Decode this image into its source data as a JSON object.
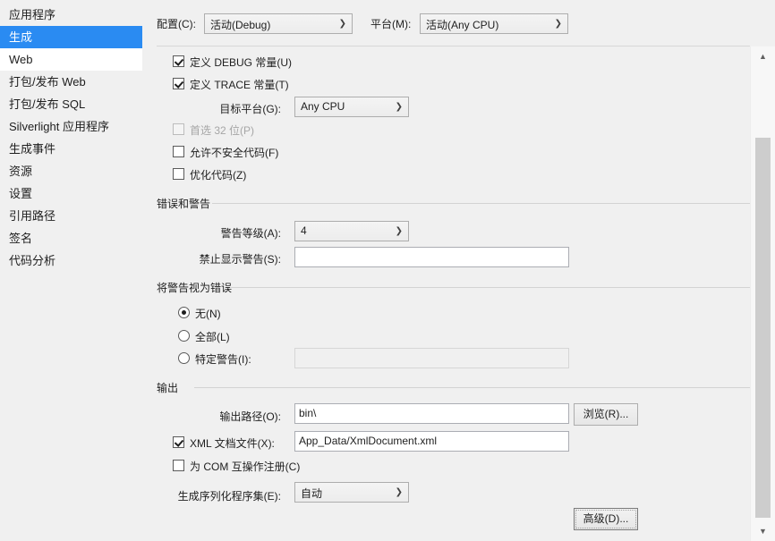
{
  "sidebar": {
    "items": [
      {
        "label": "应用程序",
        "state": "normal"
      },
      {
        "label": "生成",
        "state": "selected"
      },
      {
        "label": "Web",
        "state": "hover"
      },
      {
        "label": "打包/发布 Web",
        "state": "normal"
      },
      {
        "label": "打包/发布 SQL",
        "state": "normal"
      },
      {
        "label": "Silverlight 应用程序",
        "state": "normal"
      },
      {
        "label": "生成事件",
        "state": "normal"
      },
      {
        "label": "资源",
        "state": "normal"
      },
      {
        "label": "设置",
        "state": "normal"
      },
      {
        "label": "引用路径",
        "state": "normal"
      },
      {
        "label": "签名",
        "state": "normal"
      },
      {
        "label": "代码分析",
        "state": "normal"
      }
    ],
    "selected_color": "#2a8bf2"
  },
  "header": {
    "configuration_label": "配置(C):",
    "configuration_value": "活动(Debug)",
    "platform_label": "平台(M):",
    "platform_value": "活动(Any CPU)"
  },
  "general": {
    "define_debug_label": "定义 DEBUG 常量(U)",
    "define_debug_checked": true,
    "define_trace_label": "定义 TRACE 常量(T)",
    "define_trace_checked": true,
    "target_platform_label": "目标平台(G):",
    "target_platform_value": "Any CPU",
    "prefer32_label": "首选 32 位(P)",
    "prefer32_checked": false,
    "prefer32_disabled": true,
    "allow_unsafe_label": "允许不安全代码(F)",
    "allow_unsafe_checked": false,
    "optimize_label": "优化代码(Z)",
    "optimize_checked": false
  },
  "errors_warnings": {
    "group_title": "错误和警告",
    "warning_level_label": "警告等级(A):",
    "warning_level_value": "4",
    "suppress_warnings_label": "禁止显示警告(S):",
    "suppress_warnings_value": ""
  },
  "treat_warnings": {
    "group_title": "将警告视为错误",
    "options": [
      {
        "label": "无(N)",
        "selected": true
      },
      {
        "label": "全部(L)",
        "selected": false
      },
      {
        "label": "特定警告(I):",
        "selected": false
      }
    ],
    "specific_warnings_value": "",
    "specific_warnings_disabled": true
  },
  "output": {
    "group_title": "输出",
    "output_path_label": "输出路径(O):",
    "output_path_value": "bin\\",
    "browse_button": "浏览(R)...",
    "xml_doc_label": "XML 文档文件(X):",
    "xml_doc_checked": true,
    "xml_doc_value": "App_Data/XmlDocument.xml",
    "com_interop_label": "为 COM 互操作注册(C)",
    "com_interop_checked": false,
    "serialization_label": "生成序列化程序集(E):",
    "serialization_value": "自动",
    "advanced_button": "高级(D)..."
  },
  "scrollbar": {
    "up_glyph": "▲",
    "down_glyph": "▼"
  }
}
